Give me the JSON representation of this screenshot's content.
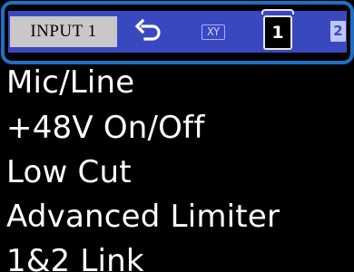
{
  "tabs": {
    "input_label": "INPUT 1",
    "back_icon": "return-arrow-icon",
    "xy_label": "XY",
    "channel_1_label": "1",
    "channel_2_label": "2"
  },
  "menu": {
    "items": [
      {
        "label": "Mic/Line"
      },
      {
        "label": "+48V On/Off"
      },
      {
        "label": "Low Cut"
      },
      {
        "label": "Advanced Limiter"
      },
      {
        "label": "1&2 Link"
      }
    ]
  },
  "colors": {
    "tab_bar": "#3a48c0",
    "highlight_outline": "#1f6fc4",
    "selected_tab_bg": "#c8c8c8",
    "screen_bg": "#000000",
    "text": "#ffffff"
  }
}
